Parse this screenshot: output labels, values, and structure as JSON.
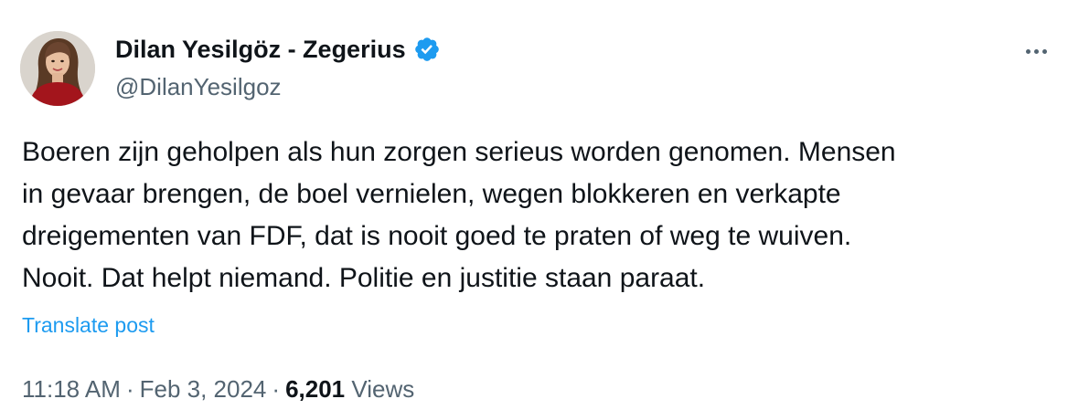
{
  "author": {
    "display_name": "Dilan Yesilgöz - Zegerius",
    "handle": "@DilanYesilgoz",
    "verified": true
  },
  "tweet": {
    "lines": [
      "Boeren zijn geholpen als hun zorgen serieus worden genomen. Mensen",
      "in gevaar brengen, de boel vernielen, wegen blokkeren en verkapte",
      "dreigementen van FDF, dat is nooit goed te praten of weg te wuiven.",
      "Nooit. Dat helpt niemand. Politie en justitie staan paraat."
    ],
    "translate_label": "Translate post"
  },
  "meta": {
    "time": "11:18 AM",
    "separator": "·",
    "date": "Feb 3, 2024",
    "views_count": "6,201",
    "views_label": "Views"
  },
  "icons": {
    "verified": "verified-badge-icon",
    "more": "more-horizontal-icon"
  },
  "colors": {
    "text": "#0f1419",
    "secondary": "#536471",
    "link": "#1d9bf0",
    "verified": "#1d9bf0"
  }
}
